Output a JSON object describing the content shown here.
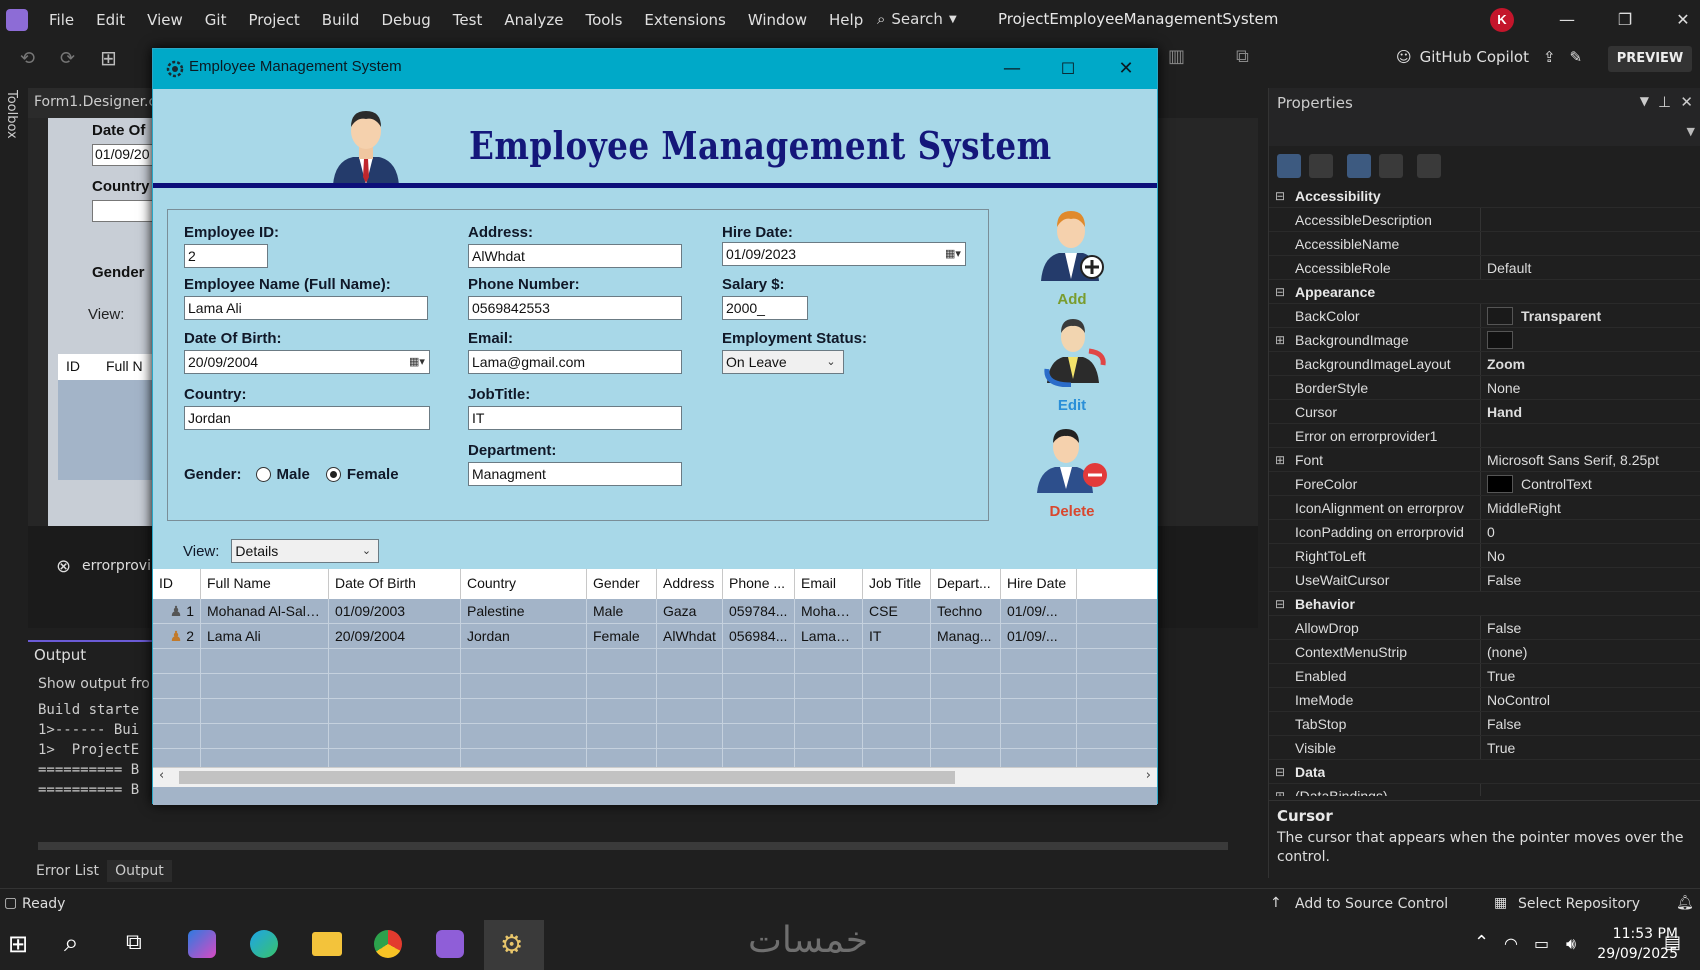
{
  "vs": {
    "menu": [
      "File",
      "Edit",
      "View",
      "Git",
      "Project",
      "Build",
      "Debug",
      "Test",
      "Analyze",
      "Tools",
      "Extensions",
      "Window",
      "Help"
    ],
    "search_label": "Search",
    "solution_title": "ProjectEmployeeManagementSystem",
    "avatar_letter": "K",
    "copilot_label": "GitHub Copilot",
    "preview_label": "PREVIEW",
    "toolbox_label": "Toolbox",
    "doc_tab": "Form1.Designer.c",
    "designer_labels": [
      "Date Of",
      "01/09/20",
      "Country",
      "Gender",
      "View:",
      "ID",
      "Full N",
      "errorprovi"
    ],
    "output": {
      "header": "Output",
      "show_from": "Show output fro",
      "lines": [
        "Build starte",
        "1>------ Bui",
        "1>  ProjectE",
        "========== B",
        "========== B"
      ]
    },
    "bottom_tabs": [
      "Error List",
      "Output"
    ],
    "status": {
      "ready": "Ready",
      "source_control": "Add to Source Control",
      "repository": "Select Repository"
    },
    "taskbar": {
      "time": "11:53 PM",
      "date": "29/09/2025",
      "watermark": "خمسات"
    }
  },
  "properties": {
    "header": "Properties",
    "rows": [
      {
        "type": "cat",
        "name": "Accessibility"
      },
      {
        "name": "AccessibleDescription",
        "value": ""
      },
      {
        "name": "AccessibleName",
        "value": ""
      },
      {
        "name": "AccessibleRole",
        "value": "Default"
      },
      {
        "type": "cat",
        "name": "Appearance"
      },
      {
        "name": "BackColor",
        "value": "Transparent",
        "bold": true,
        "swatch": "#1a1a1a"
      },
      {
        "name": "BackgroundImage",
        "value": "",
        "expand": true,
        "swatch": "#111"
      },
      {
        "name": "BackgroundImageLayout",
        "value": "Zoom",
        "bold": true
      },
      {
        "name": "BorderStyle",
        "value": "None"
      },
      {
        "name": "Cursor",
        "value": "Hand",
        "bold": true
      },
      {
        "name": "Error on errorprovider1",
        "value": ""
      },
      {
        "name": "Font",
        "value": "Microsoft Sans Serif, 8.25pt",
        "expand": true
      },
      {
        "name": "ForeColor",
        "value": "ControlText",
        "swatch": "#000"
      },
      {
        "name": "IconAlignment on errorprov",
        "value": "MiddleRight"
      },
      {
        "name": "IconPadding on errorprovid",
        "value": "0"
      },
      {
        "name": "RightToLeft",
        "value": "No"
      },
      {
        "name": "UseWaitCursor",
        "value": "False"
      },
      {
        "type": "cat",
        "name": "Behavior"
      },
      {
        "name": "AllowDrop",
        "value": "False"
      },
      {
        "name": "ContextMenuStrip",
        "value": "(none)"
      },
      {
        "name": "Enabled",
        "value": "True"
      },
      {
        "name": "ImeMode",
        "value": "NoControl"
      },
      {
        "name": "TabStop",
        "value": "False"
      },
      {
        "name": "Visible",
        "value": "True"
      },
      {
        "type": "cat",
        "name": "Data"
      },
      {
        "name": "(DataBindings)",
        "value": "",
        "expand": true
      }
    ],
    "desc_title": "Cursor",
    "desc_text": "The cursor that appears when the pointer moves over the control."
  },
  "app": {
    "window_title": "Employee Management System",
    "banner": "Employee Management System",
    "fields": {
      "employee_id": {
        "label": "Employee ID:",
        "value": "2"
      },
      "full_name": {
        "label": "Employee Name (Full Name):",
        "value": "Lama Ali"
      },
      "dob": {
        "label": "Date Of Birth:",
        "value": "20/09/2004"
      },
      "country": {
        "label": "Country:",
        "value": "Jordan"
      },
      "gender": {
        "label": "Gender:",
        "male": "Male",
        "female": "Female"
      },
      "address": {
        "label": "Address:",
        "value": "AlWhdat"
      },
      "phone": {
        "label": "Phone Number:",
        "value": "0569842553"
      },
      "email": {
        "label": "Email:",
        "value": "Lama@gmail.com"
      },
      "job_title": {
        "label": "JobTitle:",
        "value": "IT"
      },
      "department": {
        "label": "Department:",
        "value": "Managment"
      },
      "hire_date": {
        "label": "Hire Date:",
        "value": "01/09/2023"
      },
      "salary": {
        "label": "Salary $:",
        "value": "2000_"
      },
      "status": {
        "label": "Employment Status:",
        "value": "On Leave"
      }
    },
    "actions": {
      "add": "Add",
      "edit": "Edit",
      "delete": "Delete"
    },
    "view": {
      "label": "View:",
      "value": "Details"
    },
    "grid": {
      "columns": [
        "ID",
        "Full Name",
        "Date Of Birth",
        "Country",
        "Gender",
        "Address",
        "Phone ...",
        "Email",
        "Job Title",
        "Depart...",
        "Hire Date"
      ],
      "rows": [
        [
          "1",
          "Mohanad Al-Saloul",
          "01/09/2003",
          "Palestine",
          "Male",
          "Gaza",
          "059784...",
          "Mohana...",
          "CSE",
          "Techno",
          "01/09/..."
        ],
        [
          "2",
          "Lama Ali",
          "20/09/2004",
          "Jordan",
          "Female",
          "AlWhdat",
          "056984...",
          "Lama@...",
          "IT",
          "Manag...",
          "01/09/..."
        ]
      ]
    }
  }
}
